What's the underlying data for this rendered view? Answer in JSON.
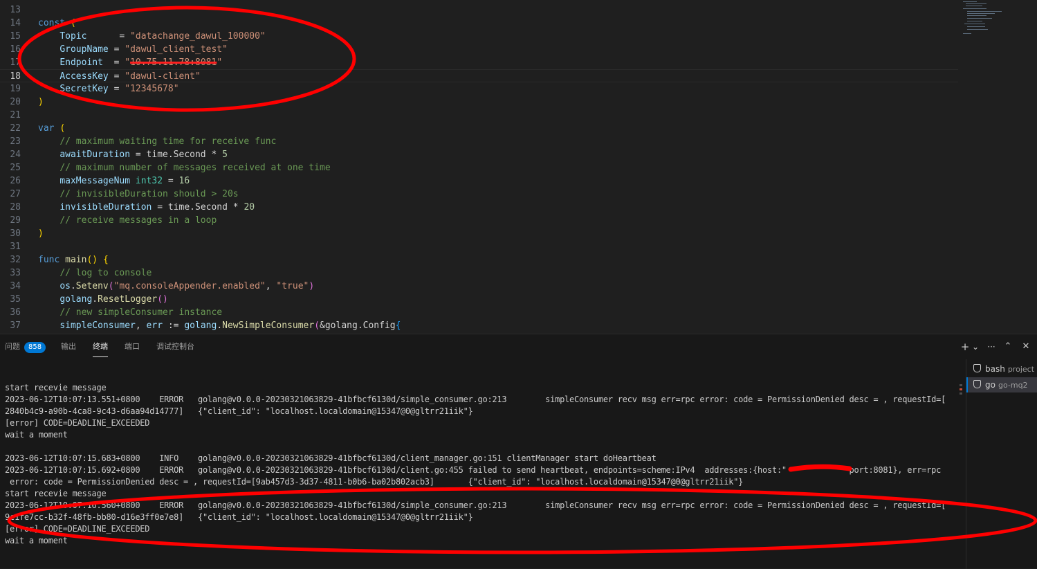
{
  "editor": {
    "lines": [
      {
        "n": "13",
        "cur": false,
        "tokens": []
      },
      {
        "n": "14",
        "cur": false,
        "tokens": [
          {
            "t": "const",
            "c": "kw"
          },
          {
            "t": " ",
            "c": "op"
          },
          {
            "t": "(",
            "c": "br1"
          }
        ]
      },
      {
        "n": "15",
        "cur": false,
        "tokens": [
          {
            "t": "    ",
            "c": "op"
          },
          {
            "t": "Topic",
            "c": "id"
          },
          {
            "t": "      = ",
            "c": "op"
          },
          {
            "t": "\"datachange_dawul_100000\"",
            "c": "str"
          }
        ]
      },
      {
        "n": "16",
        "cur": false,
        "tokens": [
          {
            "t": "    ",
            "c": "op"
          },
          {
            "t": "GroupName",
            "c": "id"
          },
          {
            "t": " = ",
            "c": "op"
          },
          {
            "t": "\"dawul_client_test\"",
            "c": "str"
          }
        ]
      },
      {
        "n": "17",
        "cur": false,
        "tokens": [
          {
            "t": "    ",
            "c": "op"
          },
          {
            "t": "Endpoint",
            "c": "id"
          },
          {
            "t": "  = ",
            "c": "op"
          },
          {
            "t": "\"",
            "c": "str"
          },
          {
            "t": "10.75.11.78:8081",
            "c": "str redacted"
          },
          {
            "t": "\"",
            "c": "str"
          }
        ]
      },
      {
        "n": "18",
        "cur": true,
        "tokens": [
          {
            "t": "    ",
            "c": "op"
          },
          {
            "t": "AccessKey",
            "c": "id"
          },
          {
            "t": " = ",
            "c": "op"
          },
          {
            "t": "\"dawul-client\"",
            "c": "str"
          }
        ]
      },
      {
        "n": "19",
        "cur": false,
        "tokens": [
          {
            "t": "    ",
            "c": "op"
          },
          {
            "t": "SecretKey",
            "c": "id"
          },
          {
            "t": " = ",
            "c": "op"
          },
          {
            "t": "\"12345678\"",
            "c": "str"
          }
        ]
      },
      {
        "n": "20",
        "cur": false,
        "tokens": [
          {
            "t": ")",
            "c": "br1"
          }
        ]
      },
      {
        "n": "21",
        "cur": false,
        "tokens": []
      },
      {
        "n": "22",
        "cur": false,
        "tokens": [
          {
            "t": "var",
            "c": "kw"
          },
          {
            "t": " ",
            "c": "op"
          },
          {
            "t": "(",
            "c": "br1"
          }
        ]
      },
      {
        "n": "23",
        "cur": false,
        "tokens": [
          {
            "t": "    ",
            "c": "op"
          },
          {
            "t": "// maximum waiting time for receive func",
            "c": "cm"
          }
        ]
      },
      {
        "n": "24",
        "cur": false,
        "tokens": [
          {
            "t": "    ",
            "c": "op"
          },
          {
            "t": "awaitDuration",
            "c": "id"
          },
          {
            "t": " = time.Second * ",
            "c": "op"
          },
          {
            "t": "5",
            "c": "num"
          }
        ]
      },
      {
        "n": "25",
        "cur": false,
        "tokens": [
          {
            "t": "    ",
            "c": "op"
          },
          {
            "t": "// maximum number of messages received at one time",
            "c": "cm"
          }
        ]
      },
      {
        "n": "26",
        "cur": false,
        "tokens": [
          {
            "t": "    ",
            "c": "op"
          },
          {
            "t": "maxMessageNum",
            "c": "id"
          },
          {
            "t": " ",
            "c": "op"
          },
          {
            "t": "int32",
            "c": "ty"
          },
          {
            "t": " = ",
            "c": "op"
          },
          {
            "t": "16",
            "c": "num"
          }
        ]
      },
      {
        "n": "27",
        "cur": false,
        "tokens": [
          {
            "t": "    ",
            "c": "op"
          },
          {
            "t": "// invisibleDuration should > 20s",
            "c": "cm"
          }
        ]
      },
      {
        "n": "28",
        "cur": false,
        "tokens": [
          {
            "t": "    ",
            "c": "op"
          },
          {
            "t": "invisibleDuration",
            "c": "id"
          },
          {
            "t": " = time.Second * ",
            "c": "op"
          },
          {
            "t": "20",
            "c": "num"
          }
        ]
      },
      {
        "n": "29",
        "cur": false,
        "tokens": [
          {
            "t": "    ",
            "c": "op"
          },
          {
            "t": "// receive messages in a loop",
            "c": "cm"
          }
        ]
      },
      {
        "n": "30",
        "cur": false,
        "tokens": [
          {
            "t": ")",
            "c": "br1"
          }
        ]
      },
      {
        "n": "31",
        "cur": false,
        "tokens": []
      },
      {
        "n": "32",
        "cur": false,
        "tokens": [
          {
            "t": "func",
            "c": "kw"
          },
          {
            "t": " ",
            "c": "op"
          },
          {
            "t": "main",
            "c": "fn"
          },
          {
            "t": "()",
            "c": "br1"
          },
          {
            "t": " ",
            "c": "op"
          },
          {
            "t": "{",
            "c": "br1"
          }
        ]
      },
      {
        "n": "33",
        "cur": false,
        "tokens": [
          {
            "t": "    ",
            "c": "op"
          },
          {
            "t": "// log to console",
            "c": "cm"
          }
        ]
      },
      {
        "n": "34",
        "cur": false,
        "tokens": [
          {
            "t": "    ",
            "c": "op"
          },
          {
            "t": "os",
            "c": "id"
          },
          {
            "t": ".",
            "c": "op"
          },
          {
            "t": "Setenv",
            "c": "fn"
          },
          {
            "t": "(",
            "c": "br2"
          },
          {
            "t": "\"mq.consoleAppender.enabled\"",
            "c": "str"
          },
          {
            "t": ", ",
            "c": "op"
          },
          {
            "t": "\"true\"",
            "c": "str"
          },
          {
            "t": ")",
            "c": "br2"
          }
        ]
      },
      {
        "n": "35",
        "cur": false,
        "tokens": [
          {
            "t": "    ",
            "c": "op"
          },
          {
            "t": "golang",
            "c": "id"
          },
          {
            "t": ".",
            "c": "op"
          },
          {
            "t": "ResetLogger",
            "c": "fn"
          },
          {
            "t": "()",
            "c": "br2"
          }
        ]
      },
      {
        "n": "36",
        "cur": false,
        "tokens": [
          {
            "t": "    ",
            "c": "op"
          },
          {
            "t": "// new simpleConsumer instance",
            "c": "cm"
          }
        ]
      },
      {
        "n": "37",
        "cur": false,
        "tokens": [
          {
            "t": "    ",
            "c": "op"
          },
          {
            "t": "simpleConsumer",
            "c": "id"
          },
          {
            "t": ", ",
            "c": "op"
          },
          {
            "t": "err",
            "c": "id"
          },
          {
            "t": " := ",
            "c": "op"
          },
          {
            "t": "golang",
            "c": "id"
          },
          {
            "t": ".",
            "c": "op"
          },
          {
            "t": "NewSimpleConsumer",
            "c": "fn"
          },
          {
            "t": "(",
            "c": "br2"
          },
          {
            "t": "&golang.Config",
            "c": "op"
          },
          {
            "t": "{",
            "c": "br3"
          }
        ]
      }
    ]
  },
  "panel": {
    "tabs": [
      {
        "key": "problems",
        "label": "问题",
        "badge": "858",
        "active": false
      },
      {
        "key": "output",
        "label": "输出",
        "badge": "",
        "active": false
      },
      {
        "key": "terminal",
        "label": "终端",
        "badge": "",
        "active": true
      },
      {
        "key": "ports",
        "label": "端口",
        "badge": "",
        "active": false
      },
      {
        "key": "debug-console",
        "label": "调试控制台",
        "badge": "",
        "active": false
      }
    ],
    "actions": {
      "add": "+",
      "dropdown": "⌄",
      "more": "···",
      "maximize": "⌃",
      "close": "✕"
    }
  },
  "terminal": {
    "lines": [
      "start recevie message",
      "2023-06-12T10:07:13.551+0800    ERROR   golang@v0.0.0-20230321063829-41bfbcf6130d/simple_consumer.go:213        simpleConsumer recv msg err=rpc error: code = PermissionDenied desc = , requestId=[",
      "2840b4c9-a90b-4ca8-9c43-d6aa94d14777]   {\"client_id\": \"localhost.localdomain@15347@0@gltrr21iik\"}",
      "[error] CODE=DEADLINE_EXCEEDED",
      "wait a moment",
      "",
      "2023-06-12T10:07:15.683+0800    INFO    golang@v0.0.0-20230321063829-41bfbcf6130d/client_manager.go:151 clientManager start doHeartbeat",
      "2023-06-12T10:07:15.692+0800    ERROR   golang@v0.0.0-20230321063829-41bfbcf6130d/client.go:455 failed to send heartbeat, endpoints=scheme:IPv4  addresses:{host:\"          \"  port:8081}, err=rpc",
      " error: code = PermissionDenied desc = , requestId=[9ab457d3-3d37-4811-b0b6-ba02b802acb3]       {\"client_id\": \"localhost.localdomain@15347@0@gltrr21iik\"}",
      "start recevie message",
      "2023-06-12T10:07:16.560+0800    ERROR   golang@v0.0.0-20230321063829-41bfbcf6130d/simple_consumer.go:213        simpleConsumer recv msg err=rpc error: code = PermissionDenied desc = , requestId=[",
      "9c1fe7cc-b32f-48fb-bb80-d16e3ff0e7e8]   {\"client_id\": \"localhost.localdomain@15347@0@gltrr21iik\"}",
      "[error] CODE=DEADLINE_EXCEEDED",
      "wait a moment"
    ]
  },
  "terminal_list": [
    {
      "name": "bash",
      "sub": "project",
      "selected": false
    },
    {
      "name": "go",
      "sub": "go-mq2",
      "selected": true
    }
  ],
  "colors": {
    "annotation": "#ff0000",
    "badge": "#0078d4"
  }
}
